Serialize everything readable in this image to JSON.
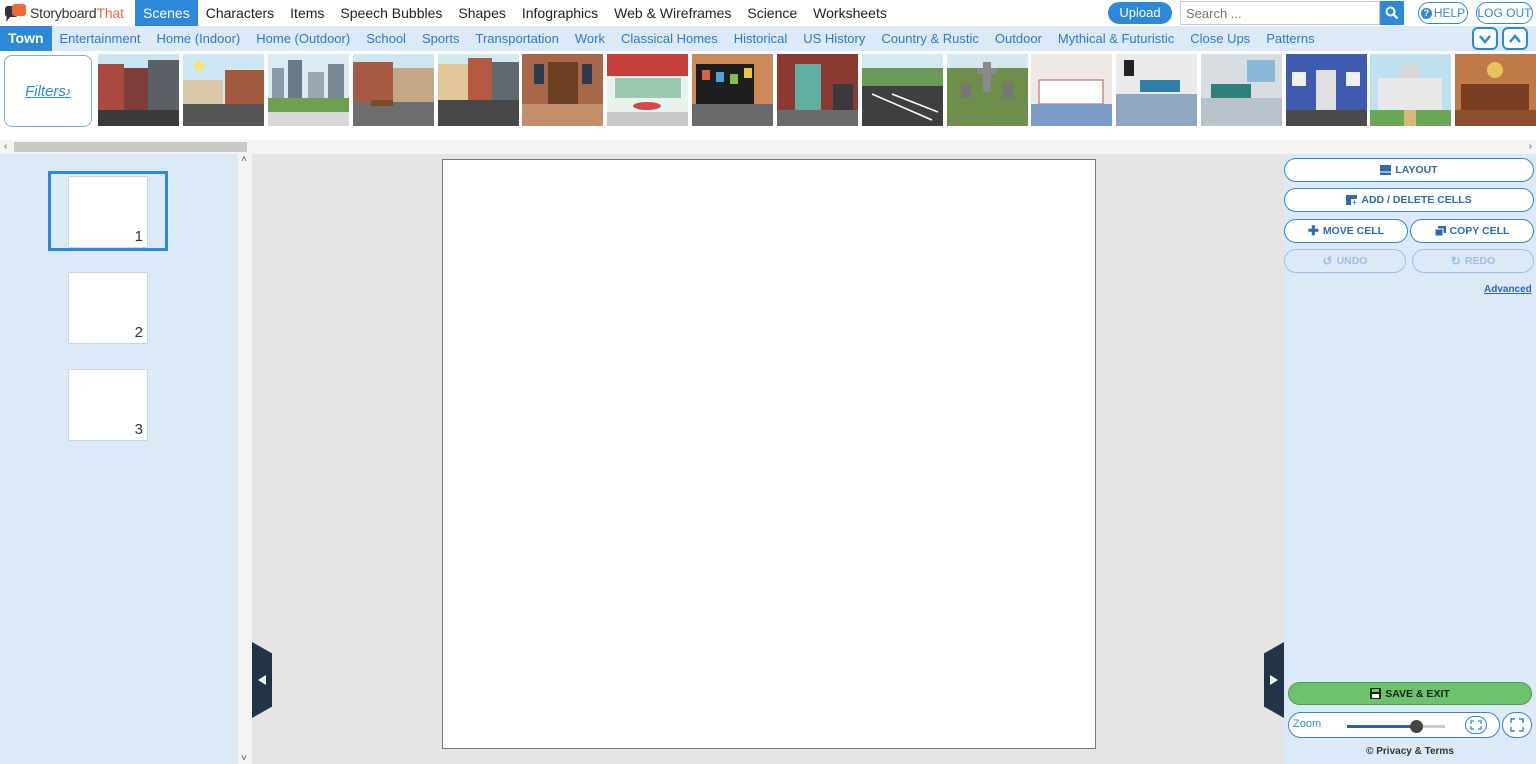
{
  "logo": {
    "text_a": "Storyboard",
    "text_b": "That"
  },
  "top_menu": [
    "Scenes",
    "Characters",
    "Items",
    "Speech Bubbles",
    "Shapes",
    "Infographics",
    "Web & Wireframes",
    "Science",
    "Worksheets"
  ],
  "upload_label": "Upload",
  "search": {
    "placeholder": "Search ..."
  },
  "help_label": "HELP",
  "logout_label": "LOG OUT",
  "categories": [
    "Town",
    "Entertainment",
    "Home (Indoor)",
    "Home (Outdoor)",
    "School",
    "Sports",
    "Transportation",
    "Work",
    "Classical Homes",
    "Historical",
    "US History",
    "Country & Rustic",
    "Outdoor",
    "Mythical & Futuristic",
    "Close Ups",
    "Patterns"
  ],
  "filters_label": "Filters›",
  "cells": [
    "1",
    "2",
    "3"
  ],
  "right_panel": {
    "layout": "LAYOUT",
    "add_delete": "ADD / DELETE CELLS",
    "move_cell": "MOVE CELL",
    "copy_cell": "COPY CELL",
    "undo": "UNDO",
    "redo": "REDO",
    "advanced": "Advanced",
    "save_exit": "SAVE & EXIT",
    "zoom_label": "Zoom",
    "zoom_level": 0.7,
    "privacy": "© Privacy & Terms"
  },
  "colors": {
    "accent": "#2e88d8",
    "panel": "#dce9f6",
    "save": "#6cc36c",
    "brand_orange": "#f0683a"
  },
  "icons": [
    "logo-bubble-icon",
    "search-icon",
    "question-icon",
    "chevron-down-icon",
    "chevron-up-icon",
    "layout-icon",
    "add-cells-icon",
    "move-icon",
    "copy-icon",
    "undo-icon",
    "redo-icon",
    "save-icon",
    "fit-screen-icon",
    "fullscreen-icon",
    "arrow-left-icon",
    "arrow-right-icon"
  ]
}
